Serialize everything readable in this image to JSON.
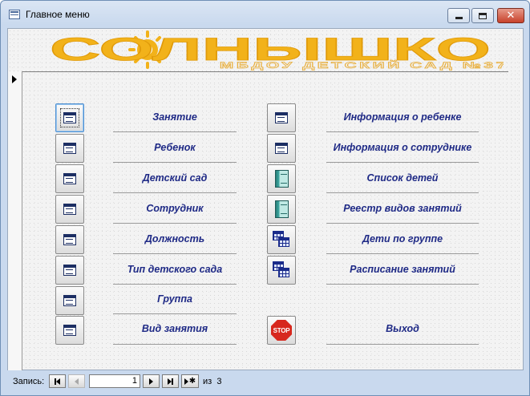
{
  "window": {
    "title": "Главное меню"
  },
  "banner": {
    "title": "СОЛНЫШКО",
    "subtitle": "МБДОУ ДЕТСКИЙ САД №37"
  },
  "left_menu": [
    {
      "label": "Занятие",
      "icon": "form-icon"
    },
    {
      "label": "Ребенок",
      "icon": "form-icon"
    },
    {
      "label": "Детский сад",
      "icon": "form-icon"
    },
    {
      "label": "Сотрудник",
      "icon": "form-icon"
    },
    {
      "label": "Должность",
      "icon": "form-icon"
    },
    {
      "label": "Тип детского сада",
      "icon": "form-icon"
    },
    {
      "label": "Группа",
      "icon": "form-icon"
    },
    {
      "label": "Вид занятия",
      "icon": "form-icon"
    }
  ],
  "right_menu": [
    {
      "label": "Информация о ребенке",
      "icon": "form-icon"
    },
    {
      "label": "Информация о сотруднике",
      "icon": "form-icon"
    },
    {
      "label": "Список детей",
      "icon": "report-icon"
    },
    {
      "label": "Реестр видов занятий",
      "icon": "report-icon"
    },
    {
      "label": "Дети по группе",
      "icon": "query-icon"
    },
    {
      "label": "Расписание занятий",
      "icon": "query-icon"
    }
  ],
  "exit": {
    "label": "Выход",
    "icon_text": "STOP"
  },
  "record_nav": {
    "label": "Запись:",
    "current": "1",
    "of_label": "из",
    "total": "3"
  },
  "colors": {
    "label_text": "#1f2a86",
    "banner": "#f2b21a",
    "stop": "#d7281e"
  }
}
